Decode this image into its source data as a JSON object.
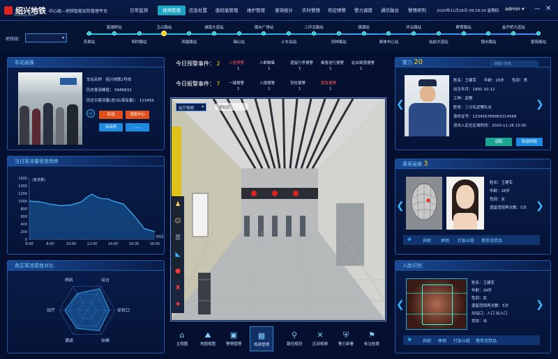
{
  "header": {
    "logo_text": "绍兴地铁",
    "logo_sub": "Shaoxing Metro",
    "platform": "中心级—地铁智能安防管理平台",
    "nav": [
      "日常监测",
      "视频管理",
      "应急处置",
      "值班值管理",
      "维护管理",
      "查询统计",
      "实时警情",
      "布控预警",
      "警力调度",
      "通信融合",
      "警情研判"
    ],
    "active_nav": 1,
    "date": "2020年11月26日",
    "time": "09:18:20",
    "weekday": "星期四",
    "user": "admin"
  },
  "line": {
    "label": "地铁线：",
    "selected": "",
    "stations_top": [
      "笛湖桥站",
      "玉山路站",
      "城南大道站",
      "镜水广场站",
      "二环北路站",
      "镜湖站",
      "环云路站",
      "群贤路站",
      "金开桥大道站"
    ],
    "stations_bottom": [
      "芳泉站",
      "阳时路站",
      "凤凰路站",
      "瑞山站",
      "火车站站",
      "凤林路站",
      "奥体中心站",
      "站前大道站",
      "镜水路站",
      "笛扬路站"
    ],
    "current": "玉山路站"
  },
  "station": {
    "title": "车站画像",
    "name_label": "车站名称",
    "name": "绍兴地铁1号线",
    "hist_label": "历史客流峰值：",
    "hist": "5689632",
    "today_label": "历史日客流量(进/出/保有量)：",
    "today": "123456",
    "btn1": "实战",
    "btn2": "消防中心",
    "btn3": "派出所",
    "btn4": "......"
  },
  "flow_chart": {
    "title": "当日客流量密度趋势"
  },
  "chart_data": {
    "type": "line",
    "ylabel": "(客流量)",
    "xlabel": "时间",
    "categories": [
      "6:00",
      "8:00",
      "10:00",
      "12:00",
      "14:00",
      "16:00",
      "18:00"
    ],
    "x": [
      6,
      7,
      8,
      9,
      10,
      11,
      11.5,
      12,
      12.5,
      13,
      13.5,
      14,
      15,
      16,
      17,
      18
    ],
    "values": [
      1000,
      980,
      920,
      880,
      900,
      980,
      1100,
      1180,
      1100,
      1060,
      1060,
      1000,
      920,
      620,
      280,
      200
    ],
    "ylim": [
      0,
      1600
    ],
    "yticks": [
      0,
      200,
      400,
      600,
      800,
      1000,
      1200,
      1400,
      1600
    ]
  },
  "radar": {
    "title": "各区客流密度对比",
    "axes": [
      "站台",
      "安检口",
      "扶梯",
      "通道",
      "站厅",
      "闸机"
    ]
  },
  "events": {
    "today_alarm_label": "今日预警事件：",
    "today_alarm": "2",
    "today_event_label": "今日报警事件：",
    "today_event": "7",
    "alarm_types": [
      {
        "name": "人脸预警",
        "color": "#ff5a5a",
        "count": "1"
      },
      {
        "name": "人群聚集",
        "color": "#cfe0ff",
        "count": "1"
      },
      {
        "name": "遗留行李报警",
        "color": "#cfe0ff",
        "count": "1"
      },
      {
        "name": "乘客逆行报警",
        "color": "#cfe0ff",
        "count": "1"
      },
      {
        "name": "站台跳落报警",
        "color": "#cfe0ff",
        "count": "1"
      }
    ],
    "event_types": [
      {
        "name": "一键报警",
        "color": "#cfe0ff",
        "count": "1"
      },
      {
        "name": "入侵报警",
        "color": "#cfe0ff",
        "count": "1"
      },
      {
        "name": "安检报警",
        "color": "#cfe0ff",
        "count": "1"
      },
      {
        "name": "紧急报警",
        "color": "#ff5a5a",
        "count": "1"
      }
    ]
  },
  "video": {
    "select": "站厅视频",
    "tag": "安检区"
  },
  "bottom_nav": [
    "主视图",
    "地图视图",
    "警情管理",
    "视频管理",
    "路径规划",
    "区间视频",
    "警力部署",
    "标注检索"
  ],
  "bottom_active": 3,
  "police": {
    "title": "警力",
    "count": "20",
    "search_placeholder": "请输入姓名",
    "info": [
      "姓名：王建军　　年龄：28岁　　性别：男",
      "出生年月：1991-10-12",
      "工种：武警",
      "职务：三分队武警队长",
      "身份证号：123456789963214569",
      "进出入定位区域时间：2020-11-26 15:00"
    ],
    "btn1": "追踪",
    "btn2": "轨迹回放"
  },
  "face": {
    "title": "乘客画像",
    "count": "3",
    "info": [
      "姓名：王建军",
      "年龄：28岁",
      "性别：女",
      "遗留违规再次数：5次"
    ],
    "tags": [
      "奔跑",
      "摔倒",
      "打架斗殴",
      "携带违禁品"
    ]
  },
  "person": {
    "title": "人脸识别",
    "info": [
      "姓名：王建军",
      "年龄：28岁",
      "性别：女",
      "遗留违规再次数：5次",
      "出站口：入口 出入口",
      "状态：出"
    ],
    "tags": [
      "奔跑",
      "摔倒",
      "打架斗殴",
      "携带违禁品"
    ]
  }
}
